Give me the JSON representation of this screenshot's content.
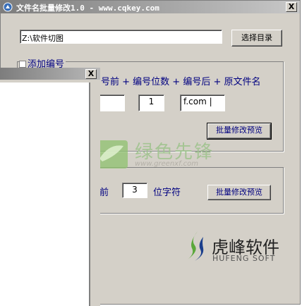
{
  "window": {
    "title": "文件名批量修改1.0 - www.cqkey.com",
    "close_label": "X"
  },
  "directory": {
    "path": "Z:\\软件切图",
    "choose_button": "选择目录"
  },
  "numbering_group": {
    "label": "添加编号",
    "formula": "号前 + 编号位数 + 编号后 + 原文件名",
    "prefix_value": "",
    "digits_value": "1",
    "suffix_value": "f.com |",
    "preview_button": "批量修改预览"
  },
  "trim_group": {
    "text_before": "前",
    "digits_value": "3",
    "text_after": "位字符",
    "preview_button": "批量修改预览"
  },
  "child_window": {
    "close_label": "X"
  },
  "watermark": {
    "cn": "绿色先锋",
    "url": "www.greenxf.com"
  },
  "logo": {
    "cn": "虎峰软件",
    "en": "HUFENG SOFT"
  },
  "colors": {
    "window_face": "#d4d0c8",
    "label_text": "#000080",
    "logo_green": "#5aa83a",
    "logo_blue": "#1a3e8c"
  }
}
